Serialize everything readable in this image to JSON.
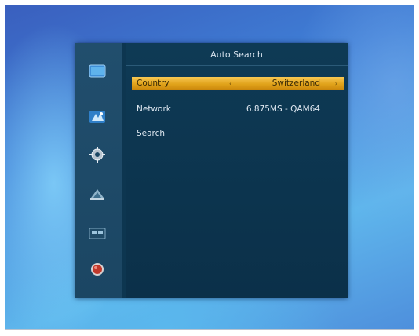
{
  "menu": {
    "title": "Auto Search",
    "rows": [
      {
        "label": "Country",
        "value": "Switzerland",
        "left_arrow": "‹",
        "right_arrow": "›"
      },
      {
        "label": "Network",
        "value": "6.875MS - QAM64"
      },
      {
        "label": "Search"
      }
    ]
  },
  "sidebar": {
    "icons": [
      "tv-icon",
      "satellite-icon",
      "settings-gear-icon",
      "tools-icon",
      "media-icon",
      "record-icon"
    ]
  },
  "colors": {
    "selection": "#e0a21a",
    "panel": "#0d3650",
    "sidebar": "#1b4663"
  }
}
